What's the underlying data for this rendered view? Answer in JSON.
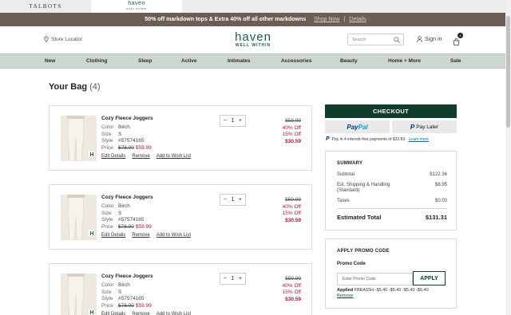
{
  "brand_tabs": [
    {
      "label": "TALBOTS"
    },
    {
      "label": "haven",
      "sub": "WELL WITHIN"
    }
  ],
  "promo": {
    "text": "50% off markdown tops & Extra 40% off all other markdowns",
    "shop_now": "Shop Now",
    "separator": "|",
    "details": "Details"
  },
  "header": {
    "store_locator": "Store Locator",
    "logo_main": "haven",
    "logo_sub": "WELL WITHIN",
    "search_placeholder": "Search",
    "sign_in": "Sign in",
    "cart_count": "4"
  },
  "nav": [
    "New",
    "Clothing",
    "Sleep",
    "Active",
    "Intimates",
    "Accessories",
    "Beauty",
    "Home + More",
    "Sale"
  ],
  "page": {
    "title": "Your Bag",
    "count": "(4)"
  },
  "item_labels": {
    "color": "Color",
    "size": "Size",
    "style": "Style",
    "price": "Price",
    "edit": "Edit Details",
    "remove": "Remove",
    "wishlist": "Add to Wish List"
  },
  "items": [
    {
      "name": "Cozy Fleece Joggers",
      "color": "Birch",
      "size": "S",
      "style": "#57574165",
      "price_orig": "$78.00",
      "price_sale": "$59.99",
      "qty": "1",
      "col_orig": "$59.99",
      "off1": "40% Off",
      "off2": "15% Off",
      "final": "$30.59"
    },
    {
      "name": "Cozy Fleece Joggers",
      "color": "Birch",
      "size": "S",
      "style": "#57574165",
      "price_orig": "$78.00",
      "price_sale": "$59.99",
      "qty": "1",
      "col_orig": "$59.99",
      "off1": "40% Off",
      "off2": "15% Off",
      "final": "$30.59"
    },
    {
      "name": "Cozy Fleece Joggers",
      "color": "Birch",
      "size": "S",
      "style": "#57574165",
      "price_orig": "$78.00",
      "price_sale": "$59.99",
      "qty": "1",
      "col_orig": "$59.99",
      "off1": "40% Off",
      "off2": "15% Off",
      "final": "$30.59"
    }
  ],
  "checkout": {
    "label": "CHECKOUT",
    "paypal_1": "Pay",
    "paypal_2": "Pal",
    "paylater_icon": "P",
    "paylater": "Pay Later",
    "note": "Pay in 4 interest-free payments of $32.83.",
    "learn_more": "Learn more"
  },
  "summary": {
    "title": "SUMMARY",
    "subtotal_label": "Subtotal",
    "subtotal": "$122.36",
    "shipping_label": "Est. Shipping & Handling (Standard)",
    "shipping": "$8.95",
    "taxes_label": "Taxes",
    "taxes": "$0.00",
    "total_label": "Estimated Total",
    "total": "$131.31"
  },
  "promo_code": {
    "title": "APPLY PROMO CODE",
    "label": "Promo Code",
    "placeholder": "Enter Promo Code",
    "apply": "APPLY",
    "applied_label": "Applied",
    "applied_text": "FBEA15H -$5.40 -$5.40 -$5.40 -$5.40",
    "remove": "Remove"
  },
  "colors": {
    "brand_green": "#0e3d2a",
    "promo_bg": "#6b5f55",
    "nav_bg": "#cbd6cc",
    "sale_red": "#a6192e"
  }
}
